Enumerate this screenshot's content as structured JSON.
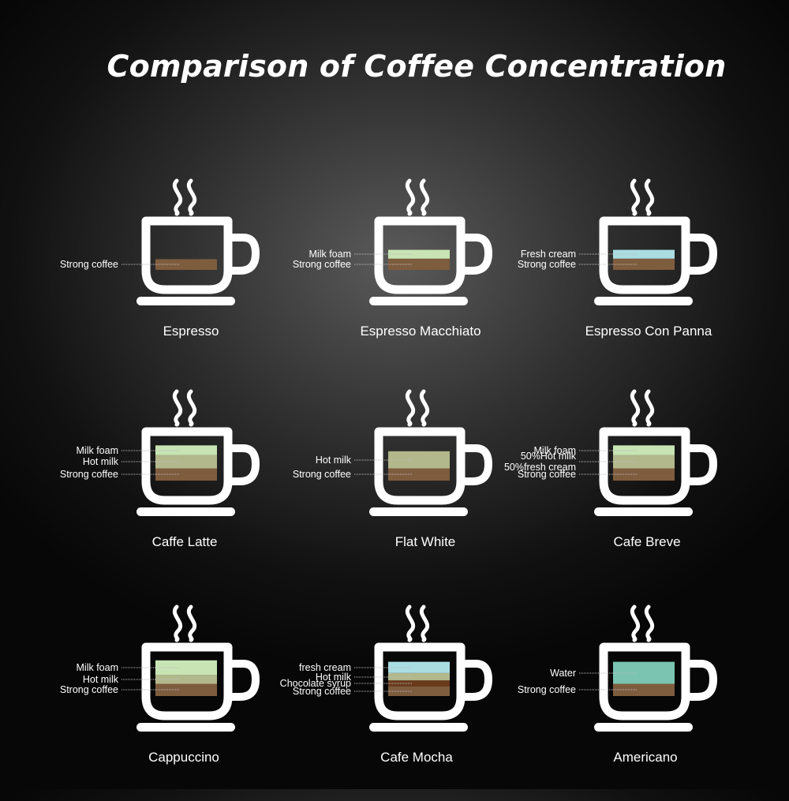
{
  "title": "Comparison of Coffee Concentration",
  "colors": {
    "strong_coffee": "#7e5c3e",
    "milk_foam": "#c8e4b4",
    "hot_milk": "#b2b88c",
    "fresh_cream": "#a9dde2",
    "chocolate_syrup": "#6a3a1c",
    "water": "#7ac4b1",
    "cup": "#ffffff"
  },
  "drinks": [
    {
      "name": "Espresso",
      "layers": [
        {
          "label": "Strong coffee",
          "color": "strong_coffee",
          "share": 0.22
        }
      ]
    },
    {
      "name": "Espresso Macchiato",
      "layers": [
        {
          "label": "Strong coffee",
          "color": "strong_coffee",
          "share": 0.23
        },
        {
          "label": "Milk foam",
          "color": "milk_foam",
          "share": 0.18
        }
      ]
    },
    {
      "name": "Espresso Con Panna",
      "layers": [
        {
          "label": "Strong coffee",
          "color": "strong_coffee",
          "share": 0.23
        },
        {
          "label": "Fresh cream",
          "color": "fresh_cream",
          "share": 0.18
        }
      ]
    },
    {
      "name": "Caffe Latte",
      "layers": [
        {
          "label": "Strong coffee",
          "color": "strong_coffee",
          "share": 0.25
        },
        {
          "label": "Hot milk",
          "color": "hot_milk",
          "share": 0.27
        },
        {
          "label": "Milk foam",
          "color": "milk_foam",
          "share": 0.2
        }
      ]
    },
    {
      "name": "Flat White",
      "layers": [
        {
          "label": "Strong coffee",
          "color": "strong_coffee",
          "share": 0.25
        },
        {
          "label": "Hot milk",
          "color": "hot_milk",
          "share": 0.35
        }
      ]
    },
    {
      "name": "Cafe Breve",
      "layers": [
        {
          "label": "Strong coffee",
          "color": "strong_coffee",
          "share": 0.25
        },
        {
          "label": "50%Hot milk\n50%fresh cream",
          "color": "hot_milk",
          "share": 0.27
        },
        {
          "label": "Milk foam",
          "color": "milk_foam",
          "share": 0.2
        }
      ]
    },
    {
      "name": "Cappuccino",
      "layers": [
        {
          "label": "Strong coffee",
          "color": "strong_coffee",
          "share": 0.25
        },
        {
          "label": "Hot milk",
          "color": "hot_milk",
          "share": 0.18
        },
        {
          "label": "Milk foam",
          "color": "milk_foam",
          "share": 0.3
        }
      ]
    },
    {
      "name": "Cafe Mocha",
      "layers": [
        {
          "label": "Strong coffee",
          "color": "strong_coffee",
          "share": 0.2
        },
        {
          "label": "Chocolate syrup",
          "color": "chocolate_syrup",
          "share": 0.12
        },
        {
          "label": "Hot milk",
          "color": "hot_milk",
          "share": 0.15
        },
        {
          "label": "fresh cream",
          "color": "fresh_cream",
          "share": 0.23
        }
      ]
    },
    {
      "name": "Americano",
      "layers": [
        {
          "label": "Strong coffee",
          "color": "strong_coffee",
          "share": 0.25
        },
        {
          "label": "Water",
          "color": "water",
          "share": 0.45
        }
      ]
    }
  ]
}
